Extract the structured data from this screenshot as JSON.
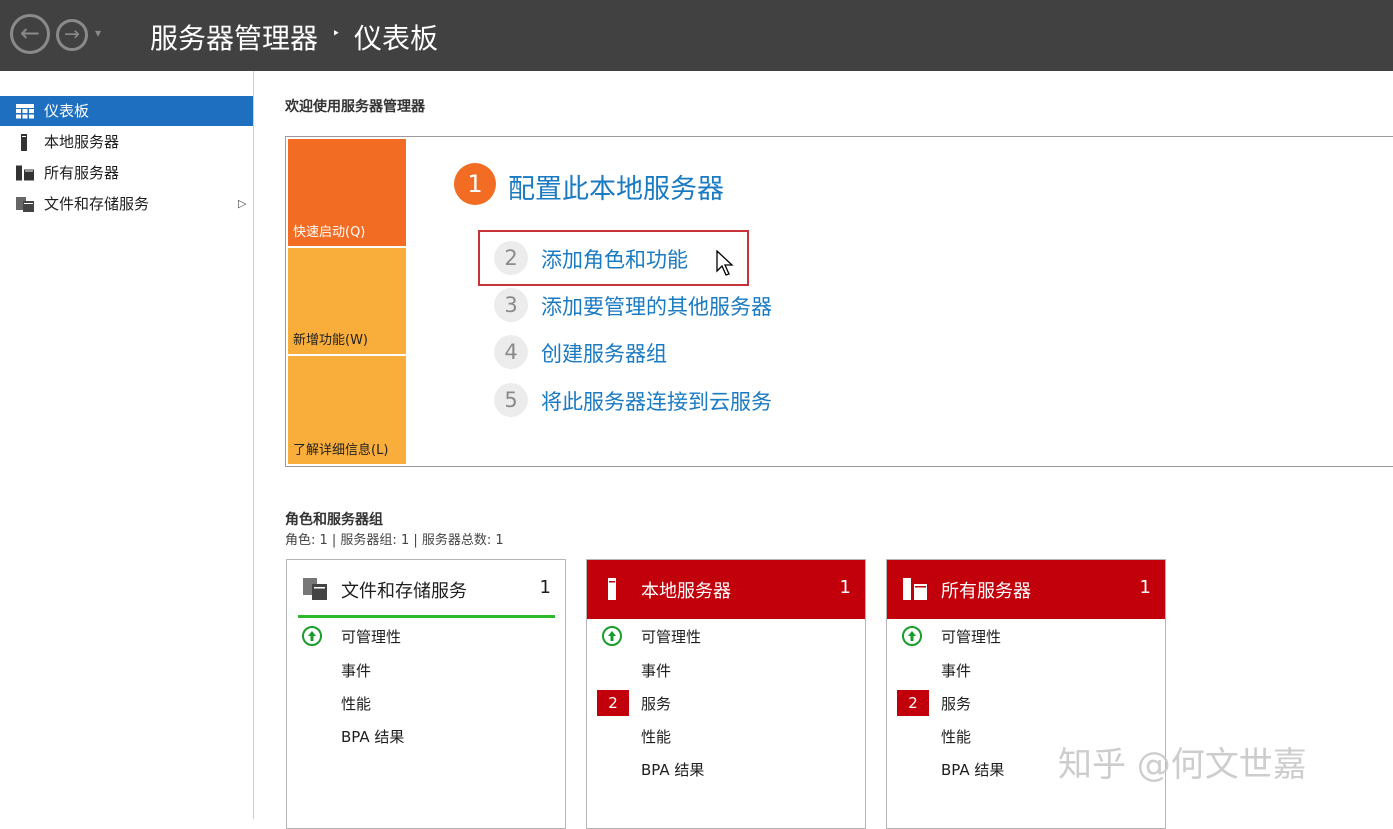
{
  "titlebar": {
    "app_title": "服务器管理器",
    "separator": "‣",
    "page_title": "仪表板",
    "back_icon": "arrow-left-icon",
    "forward_icon": "arrow-right-icon"
  },
  "sidebar": {
    "items": [
      {
        "label": "仪表板",
        "icon": "dashboard-icon",
        "active": true
      },
      {
        "label": "本地服务器",
        "icon": "server-icon"
      },
      {
        "label": "所有服务器",
        "icon": "servers-icon"
      },
      {
        "label": "文件和存储服务",
        "icon": "file-storage-icon",
        "has_submenu": true
      }
    ]
  },
  "welcome": {
    "heading": "欢迎使用服务器管理器",
    "tiles": {
      "quick_start": "快速启动(Q)",
      "whats_new": "新增功能(W)",
      "learn_more": "了解详细信息(L)"
    },
    "steps": [
      {
        "number": "1",
        "label": "配置此本地服务器"
      },
      {
        "number": "2",
        "label": "添加角色和功能"
      },
      {
        "number": "3",
        "label": "添加要管理的其他服务器"
      },
      {
        "number": "4",
        "label": "创建服务器组"
      },
      {
        "number": "5",
        "label": "将此服务器连接到云服务"
      }
    ]
  },
  "roles": {
    "title": "角色和服务器组",
    "summary": "角色: 1 | 服务器组: 1 | 服务器总数: 1",
    "cards": [
      {
        "title": "文件和存储服务",
        "count": "1",
        "status_color": "#2db82d",
        "rows": [
          "可管理性",
          "事件",
          "性能",
          "BPA 结果"
        ]
      },
      {
        "title": "本地服务器",
        "count": "1",
        "status_color": "#c2000b",
        "rows": [
          "可管理性",
          "事件",
          "服务",
          "性能",
          "BPA 结果"
        ],
        "badge": "2"
      },
      {
        "title": "所有服务器",
        "count": "1",
        "status_color": "#c2000b",
        "rows": [
          "可管理性",
          "事件",
          "服务",
          "性能",
          "BPA 结果"
        ],
        "badge": "2"
      }
    ]
  },
  "watermark": "知乎 @何文世嘉"
}
